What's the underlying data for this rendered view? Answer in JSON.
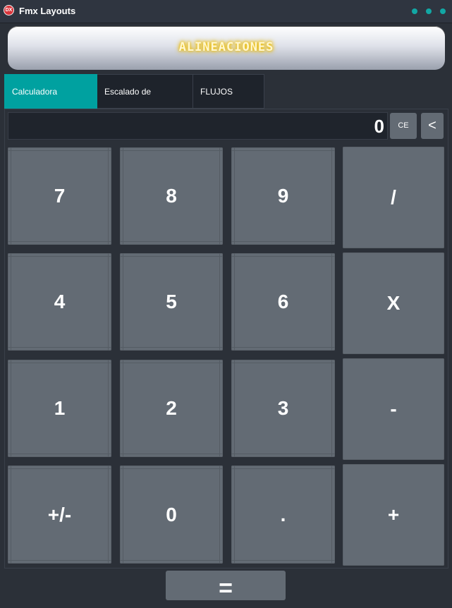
{
  "window": {
    "title": "Fmx Layouts",
    "icon_label": "DX",
    "accent": "#12a7a4"
  },
  "banner": {
    "text": "ALINEACIONES"
  },
  "tabs": [
    {
      "label": "Calculadora Estandar",
      "active": true
    },
    {
      "label": "Escalado de Imagenes",
      "active": false
    },
    {
      "label": "FLUJOS (FLOW)",
      "active": false
    }
  ],
  "display": {
    "value": "0"
  },
  "controls": {
    "ce_label": "CE",
    "back_label": "<"
  },
  "keys": {
    "k7": "7",
    "k8": "8",
    "k9": "9",
    "div": "/",
    "k4": "4",
    "k5": "5",
    "k6": "6",
    "mul": "X",
    "k1": "1",
    "k2": "2",
    "k3": "3",
    "sub": "-",
    "neg": "+/-",
    "k0": "0",
    "dot": ".",
    "add": "+"
  },
  "equals_label": "="
}
